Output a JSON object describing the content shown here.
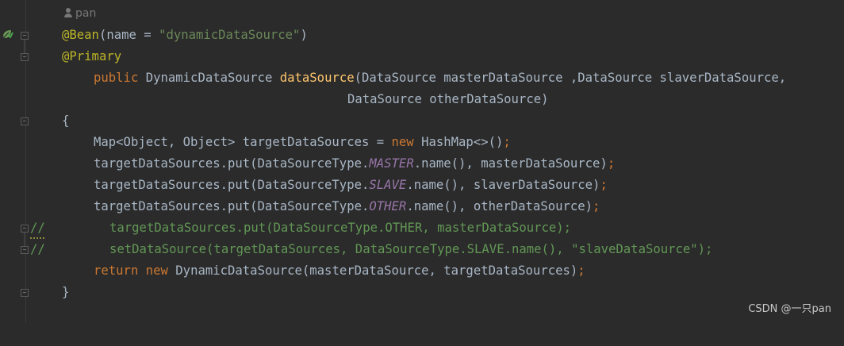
{
  "author": "pan",
  "code": {
    "l1_ann": "@Bean",
    "l1_p1": "(name = ",
    "l1_str": "\"dynamicDataSource\"",
    "l1_p2": ")",
    "l2_ann": "@Primary",
    "l3_kw": "public",
    "l3_p1": " DynamicDataSource ",
    "l3_fn": "dataSource",
    "l3_p2": "(DataSource masterDataSource ,DataSource slaverDataSource,",
    "l4": "DataSource otherDataSource)",
    "l5": "{",
    "l6_p1": "Map<Object, Object> targetDataSources = ",
    "l6_kw": "new",
    "l6_p2": " HashMap<>()",
    "l6_semi": ";",
    "l7_p1": "targetDataSources.put(DataSourceType.",
    "l7_field": "MASTER",
    "l7_p2": ".name(), masterDataSource)",
    "l7_semi": ";",
    "l8_p1": "targetDataSources.put(DataSourceType.",
    "l8_field": "SLAVE",
    "l8_p2": ".name(), slaverDataSource)",
    "l8_semi": ";",
    "l9_p1": "targetDataSources.put(DataSourceType.",
    "l9_field": "OTHER",
    "l9_p2": ".name(), otherDataSource)",
    "l9_semi": ";",
    "l10_comment": "//",
    "l10": "targetDataSources.put(DataSourceType.OTHER, masterDataSource);",
    "l11_comment": "//",
    "l11": "setDataSource(targetDataSources, DataSourceType.SLAVE.name(), \"slaveDataSource\");",
    "l12_kw1": "return",
    "l12_kw2": "new",
    "l12_p1": " DynamicDataSource(masterDataSource, targetDataSources)",
    "l12_semi": ";",
    "l13": "}"
  },
  "watermark": "CSDN @一只pan",
  "icons": [
    "user-icon",
    "bean-gutter-icon",
    "fold-marker-icon"
  ]
}
